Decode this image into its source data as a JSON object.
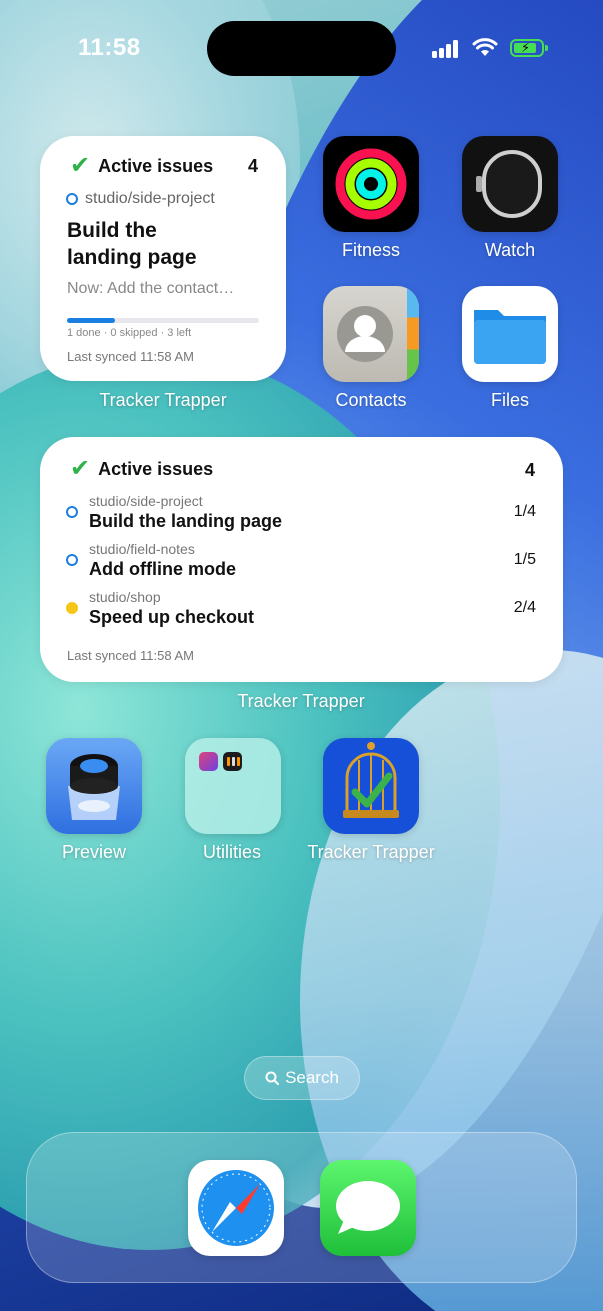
{
  "status_bar": {
    "time": "11:58"
  },
  "widget_small": {
    "title": "Active issues",
    "count": "4",
    "repo": "studio/side-project",
    "task": "Build the landing page",
    "now": "Now: Add the contact…",
    "progress": 0.25,
    "progress_text": "1 done · 0 skipped · 3 left",
    "synced": "Last synced 11:58 AM",
    "label": "Tracker Trapper"
  },
  "widget_large": {
    "title": "Active issues",
    "count": "4",
    "items": [
      {
        "repo": "studio/side-project",
        "task": "Build the landing page",
        "progress": "1/4",
        "status": "ring"
      },
      {
        "repo": "studio/field-notes",
        "task": "Add offline mode",
        "progress": "1/5",
        "status": "ring"
      },
      {
        "repo": "studio/shop",
        "task": "Speed up checkout",
        "progress": "2/4",
        "status": "dot"
      }
    ],
    "synced": "Last synced 11:58 AM",
    "label": "Tracker Trapper"
  },
  "apps": {
    "fitness": "Fitness",
    "watch": "Watch",
    "contacts": "Contacts",
    "files": "Files",
    "preview": "Preview",
    "utilities": "Utilities",
    "tracker": "Tracker Trapper"
  },
  "search": {
    "label": "Search"
  },
  "dock": {
    "apps": [
      "safari-icon",
      "messages-icon"
    ]
  },
  "colors": {
    "accent_blue": "#1a7fe0",
    "check_green": "#2fb24a",
    "status_yellow": "#f5c518"
  }
}
